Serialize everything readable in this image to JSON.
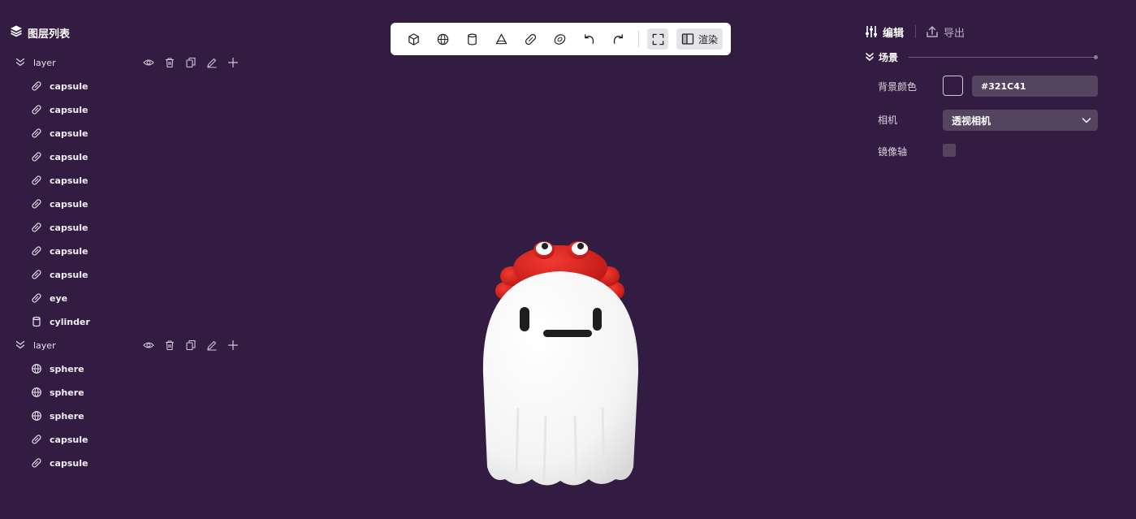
{
  "layers_panel": {
    "title": "图层列表",
    "layers": [
      {
        "name": "layer",
        "items": [
          {
            "icon": "capsule-icon",
            "label": "capsule"
          },
          {
            "icon": "capsule-icon",
            "label": "capsule"
          },
          {
            "icon": "capsule-icon",
            "label": "capsule"
          },
          {
            "icon": "capsule-icon",
            "label": "capsule"
          },
          {
            "icon": "capsule-icon",
            "label": "capsule"
          },
          {
            "icon": "capsule-icon",
            "label": "capsule"
          },
          {
            "icon": "capsule-icon",
            "label": "capsule"
          },
          {
            "icon": "capsule-icon",
            "label": "capsule"
          },
          {
            "icon": "capsule-icon",
            "label": "capsule"
          },
          {
            "icon": "capsule-icon",
            "label": "eye"
          },
          {
            "icon": "cylinder-icon",
            "label": "cylinder"
          }
        ]
      },
      {
        "name": "layer",
        "items": [
          {
            "icon": "sphere-icon",
            "label": "sphere"
          },
          {
            "icon": "sphere-icon",
            "label": "sphere"
          },
          {
            "icon": "sphere-icon",
            "label": "sphere"
          },
          {
            "icon": "capsule-icon",
            "label": "capsule"
          },
          {
            "icon": "capsule-icon",
            "label": "capsule"
          }
        ]
      }
    ]
  },
  "toolbar": {
    "tools": [
      "cube-icon",
      "sphere-icon",
      "cylinder-icon",
      "cone-icon",
      "capsule-icon",
      "torus-icon",
      "undo-icon",
      "redo-icon"
    ],
    "render_label": "渲染"
  },
  "right_panel": {
    "tabs": {
      "edit": "编辑",
      "export": "导出"
    },
    "section_title": "场景",
    "bg_color_label": "背景颜色",
    "bg_color_value": "#321C41",
    "camera_label": "相机",
    "camera_value": "透视相机",
    "mirror_label": "镜像轴"
  },
  "colors": {
    "background": "#321C41",
    "ghost_body": "#FFFFFF",
    "crab": "#E0201C"
  }
}
